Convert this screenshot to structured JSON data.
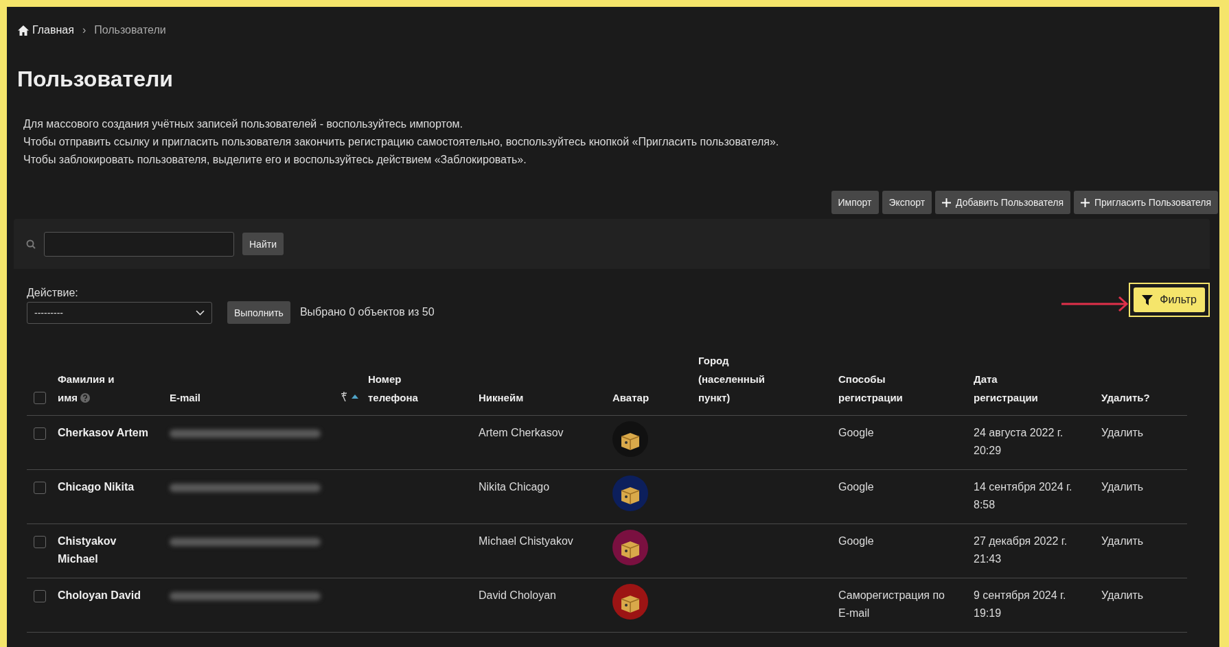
{
  "breadcrumb": {
    "home": "Главная",
    "separator": "›",
    "current": "Пользователи"
  },
  "title": "Пользователи",
  "info_lines": [
    "Для массового создания учётных записей пользователей - воспользуйтесь импортом.",
    "Чтобы отправить ссылку и пригласить пользователя закончить регистрацию самостоятельно, воспользуйтесь кнопкой «Пригласить пользователя».",
    "Чтобы заблокировать пользователя, выделите его и воспользуйтесь действием «Заблокировать»."
  ],
  "top_buttons": [
    {
      "label": "Импорт",
      "kind": "plain"
    },
    {
      "label": "Экспорт",
      "kind": "plain"
    },
    {
      "label": "Добавить Пользователя",
      "kind": "add"
    },
    {
      "label": "Пригласить Пользователя",
      "kind": "add"
    }
  ],
  "search": {
    "button": "Найти"
  },
  "action": {
    "label": "Действие:",
    "value": "---------",
    "button": "Выполнить",
    "selection_text": "Выбрано 0 объектов из 50"
  },
  "filter_button": "Фильтр",
  "table": {
    "select_all_checked": false,
    "columns": [
      {
        "label": "Фамилия и\nимя",
        "kind": "help"
      },
      {
        "label": "E-mail",
        "kind": "sorted"
      },
      {
        "label": "Номер\nтелефона",
        "kind": "text"
      },
      {
        "label": "Никнейм",
        "kind": "text"
      },
      {
        "label": "Аватар",
        "kind": "text"
      },
      {
        "label": "Город\n(населенный\nпункт)",
        "kind": "text"
      },
      {
        "label": "Способы\nрегистрации",
        "kind": "text"
      },
      {
        "label": "Дата\nрегистрации",
        "kind": "text"
      },
      {
        "label": "Удалить?",
        "kind": "text"
      }
    ],
    "rows": [
      {
        "checked": false,
        "name": "Cherkasov Artem",
        "nickname": "Artem Cherkasov",
        "avatar": {
          "color": "#111111"
        },
        "method": "Google",
        "date": "24 августа 2022 г. 20:29",
        "delete": "Удалить"
      },
      {
        "checked": false,
        "name": "Chicago Nikita",
        "nickname": "Nikita Chicago",
        "avatar": {
          "color": "#0c1f5c"
        },
        "method": "Google",
        "date": "14 сентября 2024 г. 8:58",
        "delete": "Удалить"
      },
      {
        "checked": false,
        "name": "Chistyakov Michael",
        "nickname": "Michael Chistyakov",
        "avatar": {
          "color": "#7a1040"
        },
        "method": "Google",
        "date": "27 декабря 2022 г. 21:43",
        "delete": "Удалить"
      },
      {
        "checked": false,
        "name": "Choloyan David",
        "nickname": "David Choloyan",
        "avatar": {
          "color": "#9c1414"
        },
        "method": "Саморегистрация по E-mail",
        "date": "9 сентября 2024 г. 19:19",
        "delete": "Удалить"
      }
    ]
  }
}
